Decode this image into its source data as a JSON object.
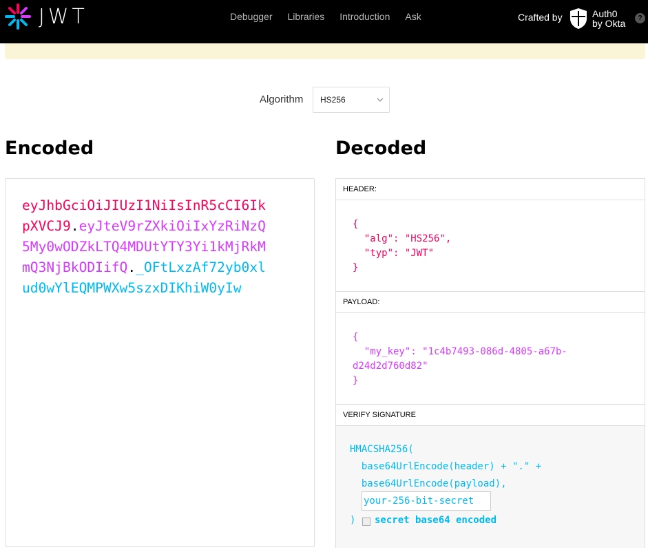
{
  "header": {
    "logo_text": "JWT",
    "nav": [
      "Debugger",
      "Libraries",
      "Introduction",
      "Ask"
    ],
    "crafted_by": "Crafted by",
    "auth0_line1": "Auth0",
    "auth0_line2": "by Okta",
    "help": "?"
  },
  "algorithm": {
    "label": "Algorithm",
    "value": "HS256"
  },
  "sections": {
    "encoded": "Encoded",
    "decoded": "Decoded"
  },
  "encoded": {
    "header": "eyJhbGciOiJIUzI1NiIsInR5cCI6IkpXVCJ9",
    "payload": "eyJteV9rZXkiOiIxYzRiNzQ5My0wODZkLTQ4MDUtYTY3Yi1kMjRkMmQ3NjBkODIifQ",
    "signature": "_OFtLxzAf72yb0xlud0wYlEQMPWXw5szxDIKhiW0yIw",
    "dot": "."
  },
  "decoded": {
    "header_title": "HEADER:",
    "header_lines": [
      "{",
      "  \"alg\": \"HS256\",",
      "  \"typ\": \"JWT\"",
      "}"
    ],
    "payload_title": "PAYLOAD:",
    "payload_lines": [
      "{",
      "  \"my_key\": \"1c4b7493-086d-4805-a67b-",
      "d24d2d760d82\"",
      "}"
    ],
    "verify_title": "VERIFY SIGNATURE",
    "verify_lines": [
      "HMACSHA256(",
      "  base64UrlEncode(header) + \".\" +",
      "  base64UrlEncode(payload),"
    ],
    "secret_placeholder": "your-256-bit-secret",
    "close_paren": ")",
    "checkbox_label": "secret base64 encoded"
  },
  "colors": {
    "header": "#fb015b",
    "payload": "#d63aff",
    "signature": "#00b9f1"
  }
}
